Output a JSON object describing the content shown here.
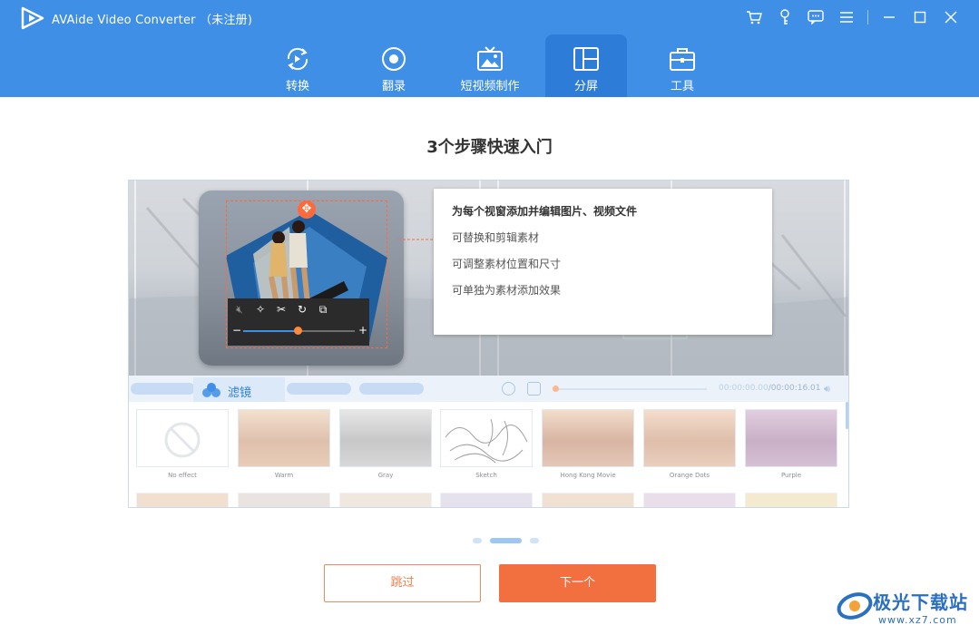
{
  "app": {
    "title": "AVAide Video Converter （未注册)"
  },
  "window_controls": [
    "cart-icon",
    "key-icon",
    "feedback-icon",
    "menu-icon",
    "minimize-icon",
    "maximize-icon",
    "close-icon"
  ],
  "nav": {
    "tabs": [
      {
        "label": "转换",
        "icon": "convert-icon"
      },
      {
        "label": "翻录",
        "icon": "ripper-icon"
      },
      {
        "label": "短视频制作",
        "icon": "mv-icon"
      },
      {
        "label": "分屏",
        "icon": "collage-icon",
        "active": true
      },
      {
        "label": "工具",
        "icon": "toolbox-icon"
      }
    ]
  },
  "main": {
    "title": "3个步骤快速入门",
    "tip": {
      "heading": "为每个视窗添加并编辑图片、视频文件",
      "items": [
        "可替换和剪辑素材",
        "可调整素材位置和尺寸",
        "可单独为素材添加效果"
      ]
    },
    "player": {
      "filter_tab": "滤镜",
      "time_current": "00:00:00.00",
      "time_total": "/00:00:16.01"
    },
    "filters": [
      {
        "label": "No effect"
      },
      {
        "label": "Warm"
      },
      {
        "label": "Gray"
      },
      {
        "label": "Sketch"
      },
      {
        "label": "Hong Kong Movie"
      },
      {
        "label": "Orange Dots"
      },
      {
        "label": "Purple"
      }
    ],
    "pager": {
      "count": 3,
      "active_index": 1
    }
  },
  "buttons": {
    "skip": "跳过",
    "next": "下一个"
  },
  "watermark": {
    "text": "极光下载站",
    "url": "www.xz7.com"
  },
  "colors": {
    "header": "#3e8fe5",
    "active_tab": "#2d7cd8",
    "primary_button": "#f2703f",
    "skip_border": "#f08a5d"
  }
}
